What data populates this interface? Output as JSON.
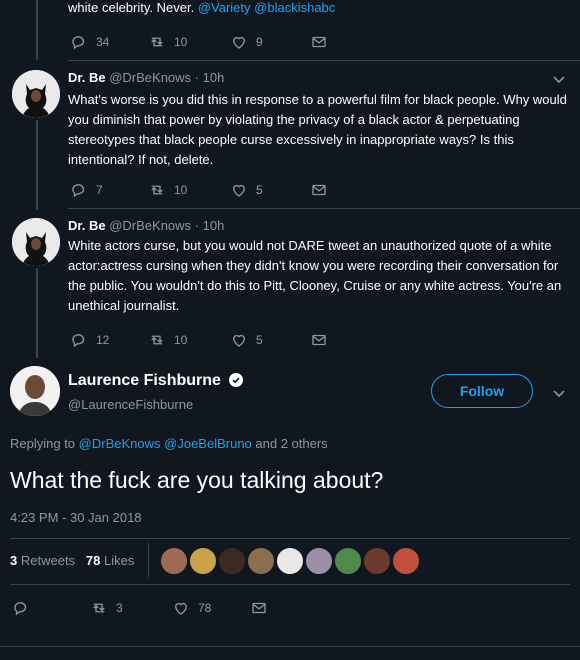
{
  "colors": {
    "background": "#10171e",
    "accent": "#1da1f2",
    "muted": "#8899a6",
    "divider": "#38444d"
  },
  "top_tweet": {
    "text_tail": "white celebrity. Never.",
    "mentions": [
      "@Variety",
      "@blackishabc"
    ],
    "replies": "34",
    "retweets": "10",
    "likes": "9"
  },
  "reply1": {
    "name": "Dr. Be",
    "handle": "@DrBeKnows",
    "time": "· 10h",
    "text": "What's worse is you did this in response to a powerful film for black people. Why would you diminish that power by violating the privacy of a black actor & perpetuating stereotypes that black people curse excessively in inappropriate ways? Is this intentional? If not, delete.",
    "replies": "7",
    "retweets": "10",
    "likes": "5"
  },
  "reply2": {
    "name": "Dr. Be",
    "handle": "@DrBeKnows",
    "time": "· 10h",
    "text": "White actors curse, but you would not DARE tweet an unauthorized quote of a white actor:actress cursing when they didn't know you were recording their conversation for the public. You wouldn't do this to Pitt, Clooney, Cruise or any white actress. You're an unethical journalist.",
    "replies": "12",
    "retweets": "10",
    "likes": "5"
  },
  "main_tweet": {
    "name": "Laurence Fishburne",
    "handle": "@LaurenceFishburne",
    "follow_label": "Follow",
    "replying_prefix": "Replying to",
    "replying_mentions": [
      "@DrBeKnows",
      "@JoeBelBruno"
    ],
    "replying_suffix": "and 2 others",
    "text": "What the fuck are you talking about?",
    "timestamp": "4:23 PM - 30 Jan 2018",
    "retweets_count": "3",
    "retweets_label": "Retweets",
    "likes_count": "78",
    "likes_label": "Likes",
    "action_retweets": "3",
    "action_likes": "78"
  }
}
